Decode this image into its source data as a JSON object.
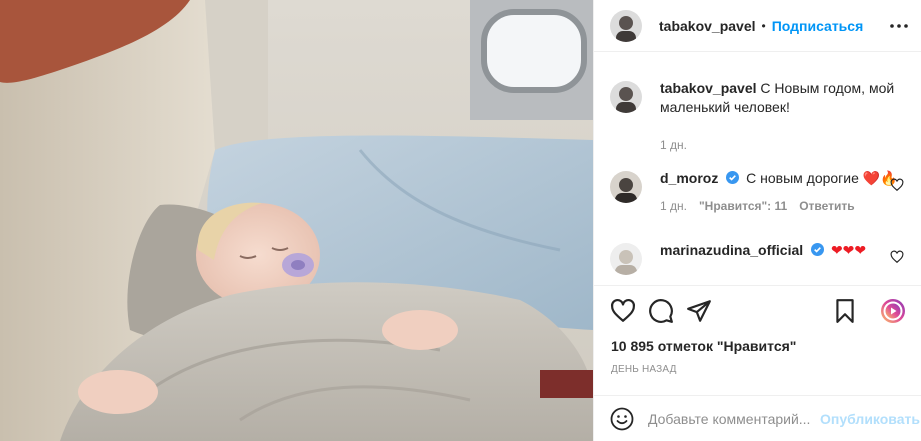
{
  "header": {
    "username": "tabakov_pavel",
    "separator": "•",
    "follow_label": "Подписаться",
    "more_icon": "more-horizontal-icon"
  },
  "caption": {
    "username": "tabakov_pavel",
    "text": "С Новым годом, мой маленький человек!",
    "time": "1 дн."
  },
  "comments": [
    {
      "username": "d_moroz",
      "verified": true,
      "text": "С новым дорогие",
      "emoji": "❤️🔥",
      "time": "1 дн.",
      "likes": "\"Нравится\": 11",
      "reply_label": "Ответить"
    },
    {
      "username": "marinazudina_official",
      "verified": true,
      "text": "",
      "emoji": "❤❤❤"
    }
  ],
  "actions": {
    "like_icon": "heart-icon",
    "comment_icon": "comment-icon",
    "share_icon": "paper-plane-icon",
    "save_icon": "bookmark-icon",
    "reels_icon": "reels-icon"
  },
  "likes_text": "10 895 отметок \"Нравится\"",
  "date_text": "ДЕНЬ НАЗАД",
  "add_comment": {
    "placeholder": "Добавьте комментарий...",
    "publish_label": "Опубликовать"
  },
  "colors": {
    "accent": "#0095f6",
    "publish_disabled": "#b2dffc",
    "verified": "#3897f0",
    "secondary_text": "#8e8e8e"
  }
}
